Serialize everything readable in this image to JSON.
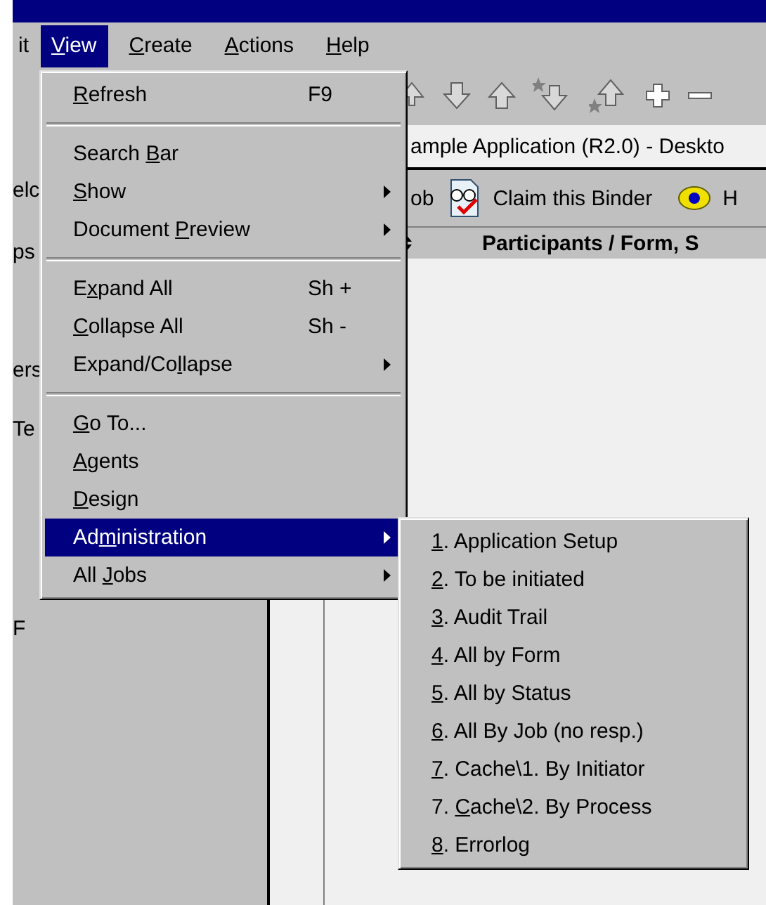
{
  "menu_bar": [
    {
      "after": "it",
      "selected": false
    },
    {
      "key": "V",
      "after": "iew",
      "selected": true
    },
    {
      "key": "C",
      "after": "reate",
      "selected": false
    },
    {
      "key": "A",
      "after": "ctions",
      "selected": false
    },
    {
      "key": "H",
      "after": "elp",
      "selected": false
    }
  ],
  "view_menu": [
    {
      "kind": "item",
      "key": "R",
      "after": "efresh",
      "shortcut": "F9",
      "submenu": false,
      "selected": false
    },
    {
      "kind": "separator"
    },
    {
      "kind": "item",
      "before": "Search ",
      "key": "B",
      "after": "ar",
      "submenu": false,
      "selected": false
    },
    {
      "kind": "item",
      "key": "S",
      "after": "how",
      "submenu": true,
      "selected": false
    },
    {
      "kind": "item",
      "before": "Document ",
      "key": "P",
      "after": "review",
      "submenu": true,
      "selected": false
    },
    {
      "kind": "separator"
    },
    {
      "kind": "item",
      "before": "E",
      "key": "x",
      "after": "pand All",
      "shortcut": "Sh +",
      "submenu": false,
      "selected": false
    },
    {
      "kind": "item",
      "key": "C",
      "after": "ollapse All",
      "shortcut": "Sh -",
      "submenu": false,
      "selected": false
    },
    {
      "kind": "item",
      "before": "Expand/Co",
      "key": "l",
      "after": "lapse",
      "submenu": true,
      "selected": false
    },
    {
      "kind": "separator"
    },
    {
      "kind": "item",
      "key": "G",
      "after": "o To...",
      "submenu": false,
      "selected": false
    },
    {
      "kind": "item",
      "key": "A",
      "after": "gents",
      "submenu": false,
      "selected": false
    },
    {
      "kind": "item",
      "key": "D",
      "after": "esign",
      "submenu": false,
      "selected": false
    },
    {
      "kind": "item",
      "before": "Ad",
      "key": "m",
      "after": "inistration",
      "submenu": true,
      "selected": true
    },
    {
      "kind": "item",
      "before": "All ",
      "key": "J",
      "after": "obs",
      "submenu": true,
      "selected": false
    }
  ],
  "administration_submenu": [
    {
      "key": "1",
      "after": ". Application Setup"
    },
    {
      "key": "2",
      "after": ". To be initiated"
    },
    {
      "key": "3",
      "after": ". Audit Trail"
    },
    {
      "key": "4",
      "after": ". All by Form"
    },
    {
      "key": "5",
      "after": ". All by Status"
    },
    {
      "key": "6",
      "after": ". All By Job (no resp.)"
    },
    {
      "key": "7",
      "after": ". Cache\\1. By Initiator"
    },
    {
      "before": "7. ",
      "key": "C",
      "after": "ache\\2. By Process"
    },
    {
      "key": "8",
      "after": ". Errorlog"
    }
  ],
  "left_panel_fragments": [
    "elc",
    "ps",
    "ers",
    "Te",
    "F"
  ],
  "document_title": "ample Application (R2.0) - Deskto",
  "toolbar": {
    "partial_label": "ob",
    "claim_label": "Claim this Binder",
    "help_partial_label": "H"
  },
  "list_header": {
    "title": "Participants / Form, S"
  }
}
